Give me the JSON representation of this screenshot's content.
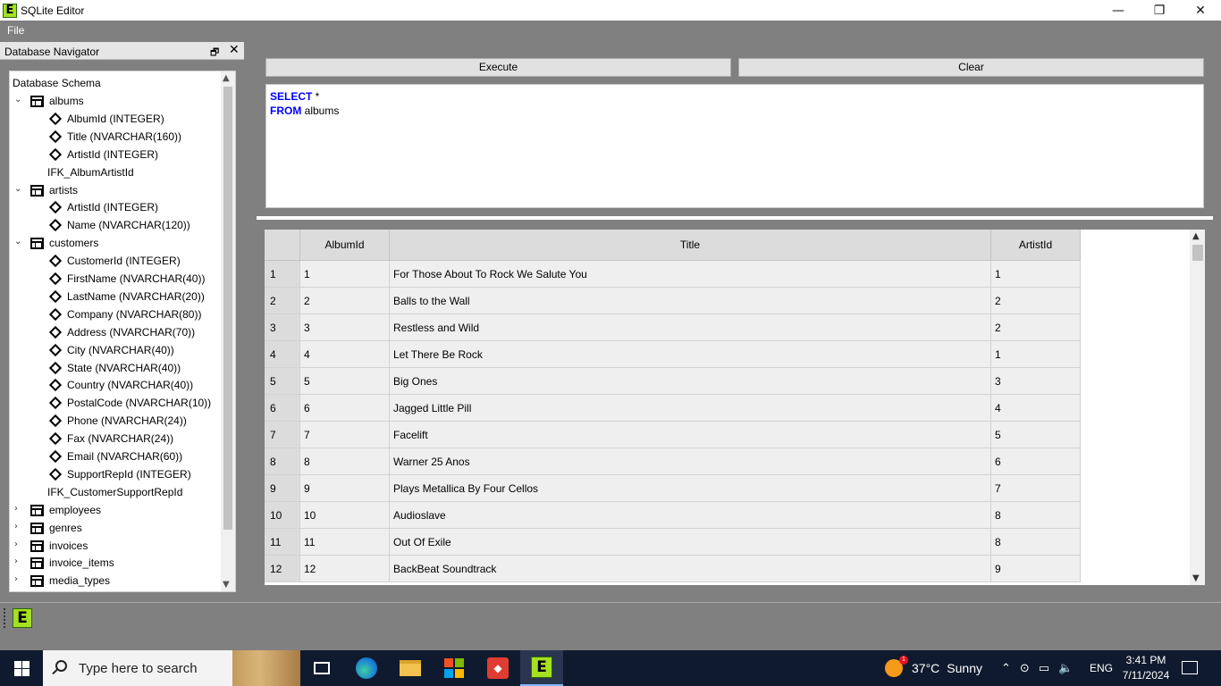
{
  "window": {
    "title": "SQLite Editor",
    "app_icon_letter": "E",
    "minimize": "—",
    "restore": "❐",
    "close": "✕"
  },
  "menu": {
    "file": "File"
  },
  "navigator": {
    "title": "Database Navigator",
    "float_icon": "🗗",
    "close_icon": "✕",
    "root": "Database Schema",
    "scroll_up": "▲",
    "scroll_down": "▼",
    "rows": [
      {
        "kind": "table",
        "label": "albums",
        "expanded": true
      },
      {
        "kind": "column",
        "label": "AlbumId (INTEGER)"
      },
      {
        "kind": "column",
        "label": "Title (NVARCHAR(160))"
      },
      {
        "kind": "column",
        "label": "ArtistId (INTEGER)"
      },
      {
        "kind": "index",
        "label": "IFK_AlbumArtistId"
      },
      {
        "kind": "table",
        "label": "artists",
        "expanded": true
      },
      {
        "kind": "column",
        "label": "ArtistId (INTEGER)"
      },
      {
        "kind": "column",
        "label": "Name (NVARCHAR(120))"
      },
      {
        "kind": "table",
        "label": "customers",
        "expanded": true
      },
      {
        "kind": "column",
        "label": "CustomerId (INTEGER)"
      },
      {
        "kind": "column",
        "label": "FirstName (NVARCHAR(40))"
      },
      {
        "kind": "column",
        "label": "LastName (NVARCHAR(20))"
      },
      {
        "kind": "column",
        "label": "Company (NVARCHAR(80))"
      },
      {
        "kind": "column",
        "label": "Address (NVARCHAR(70))"
      },
      {
        "kind": "column",
        "label": "City (NVARCHAR(40))"
      },
      {
        "kind": "column",
        "label": "State (NVARCHAR(40))"
      },
      {
        "kind": "column",
        "label": "Country (NVARCHAR(40))"
      },
      {
        "kind": "column",
        "label": "PostalCode (NVARCHAR(10))"
      },
      {
        "kind": "column",
        "label": "Phone (NVARCHAR(24))"
      },
      {
        "kind": "column",
        "label": "Fax (NVARCHAR(24))"
      },
      {
        "kind": "column",
        "label": "Email (NVARCHAR(60))"
      },
      {
        "kind": "column",
        "label": "SupportRepId (INTEGER)"
      },
      {
        "kind": "index",
        "label": "IFK_CustomerSupportRepId"
      },
      {
        "kind": "table",
        "label": "employees",
        "expanded": false
      },
      {
        "kind": "table",
        "label": "genres",
        "expanded": false
      },
      {
        "kind": "table",
        "label": "invoices",
        "expanded": false
      },
      {
        "kind": "table",
        "label": "invoice_items",
        "expanded": false
      },
      {
        "kind": "table",
        "label": "media_types",
        "expanded": false
      }
    ]
  },
  "toolbar": {
    "execute_label": "Execute",
    "clear_label": "Clear"
  },
  "editor": {
    "line1_keyword": "SELECT",
    "line1_rest": " *",
    "line2_keyword": "FROM",
    "line2_rest": " albums",
    "keyword_color": "#0000ff"
  },
  "results": {
    "columns": [
      "AlbumId",
      "Title",
      "ArtistId"
    ],
    "rows": [
      [
        "1",
        "1",
        "For Those About To Rock We Salute You",
        "1"
      ],
      [
        "2",
        "2",
        "Balls to the Wall",
        "2"
      ],
      [
        "3",
        "3",
        "Restless and Wild",
        "2"
      ],
      [
        "4",
        "4",
        "Let There Be Rock",
        "1"
      ],
      [
        "5",
        "5",
        "Big Ones",
        "3"
      ],
      [
        "6",
        "6",
        "Jagged Little Pill",
        "4"
      ],
      [
        "7",
        "7",
        "Facelift",
        "5"
      ],
      [
        "8",
        "8",
        "Warner 25 Anos",
        "6"
      ],
      [
        "9",
        "9",
        "Plays Metallica By Four Cellos",
        "7"
      ],
      [
        "10",
        "10",
        "Audioslave",
        "8"
      ],
      [
        "11",
        "11",
        "Out Of Exile",
        "8"
      ],
      [
        "12",
        "12",
        "BackBeat Soundtrack",
        "9"
      ]
    ],
    "scroll_up": "▲",
    "scroll_down": "▼"
  },
  "statusbar": {
    "icon_letter": "E"
  },
  "taskbar": {
    "search_placeholder": "Type here to search",
    "anydesk_glyph": "◆",
    "editor_letter": "E",
    "weather_badge": "1",
    "weather_temp": "37°C",
    "weather_cond": "Sunny",
    "tray_chevron": "⌃",
    "tray_meet": "⊙",
    "tray_network": "▭",
    "tray_volume": "🔈",
    "language": "ENG",
    "time": "3:41 PM",
    "date": "7/11/2024"
  }
}
